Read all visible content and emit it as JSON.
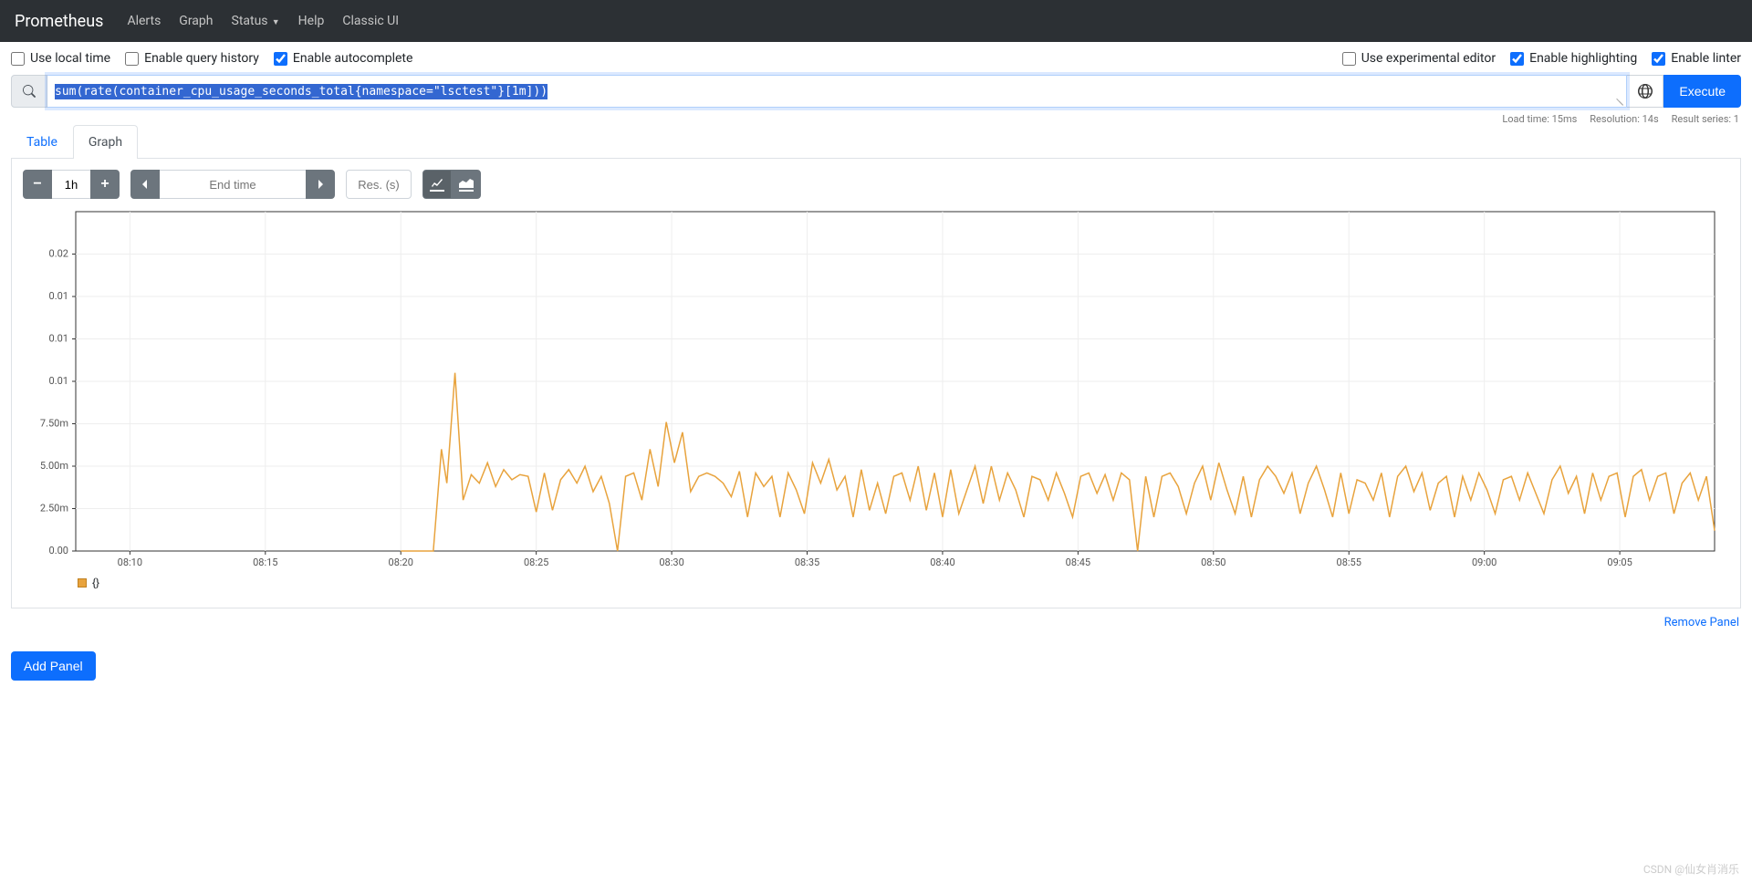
{
  "navbar": {
    "brand": "Prometheus",
    "links": [
      "Alerts",
      "Graph",
      "Status",
      "Help",
      "Classic UI"
    ],
    "status_has_caret": true
  },
  "options": {
    "use_local_time": "Use local time",
    "enable_query_history": "Enable query history",
    "enable_autocomplete": "Enable autocomplete",
    "use_experimental_editor": "Use experimental editor",
    "enable_highlighting": "Enable highlighting",
    "enable_linter": "Enable linter",
    "checked": {
      "use_local_time": false,
      "enable_query_history": false,
      "enable_autocomplete": true,
      "use_experimental_editor": false,
      "enable_highlighting": true,
      "enable_linter": true
    }
  },
  "query": {
    "expression": "sum(rate(container_cpu_usage_seconds_total{namespace=\"lsctest\"}[1m]))",
    "execute_label": "Execute"
  },
  "meta": {
    "load_time": "Load time: 15ms",
    "resolution": "Resolution: 14s",
    "result_series": "Result series: 1"
  },
  "tabs": {
    "table": "Table",
    "graph": "Graph",
    "active": "graph"
  },
  "controls": {
    "range": "1h",
    "end_time_placeholder": "End time",
    "res_placeholder": "Res. (s)"
  },
  "legend": {
    "label": "{}"
  },
  "actions": {
    "remove_panel": "Remove Panel",
    "add_panel": "Add Panel"
  },
  "watermark": "CSDN @仙女肖消乐",
  "chart_data": {
    "type": "line",
    "title": "",
    "xlabel": "",
    "ylabel": "",
    "ylim": [
      0,
      0.02
    ],
    "y_ticks": [
      "0.00",
      "2.50m",
      "5.00m",
      "7.50m",
      "0.01",
      "0.01",
      "0.01",
      "0.02"
    ],
    "y_tick_values": [
      0,
      0.0025,
      0.005,
      0.0075,
      0.01,
      0.0125,
      0.015,
      0.0175
    ],
    "x_ticks": [
      "08:10",
      "08:15",
      "08:20",
      "08:25",
      "08:30",
      "08:35",
      "08:40",
      "08:45",
      "08:50",
      "08:55",
      "09:00",
      "09:05"
    ],
    "x_tick_values": [
      0,
      5,
      10,
      15,
      20,
      25,
      30,
      35,
      40,
      45,
      50,
      55
    ],
    "x_range": [
      -2,
      58.5
    ],
    "series": [
      {
        "name": "{}",
        "color": "#e8a33d",
        "points": [
          [
            10.0,
            0.0
          ],
          [
            10.3,
            0.0
          ],
          [
            10.6,
            0.0
          ],
          [
            10.9,
            0.0
          ],
          [
            11.2,
            0.0
          ],
          [
            11.5,
            0.006
          ],
          [
            11.7,
            0.004
          ],
          [
            12.0,
            0.0105
          ],
          [
            12.3,
            0.003
          ],
          [
            12.6,
            0.0045
          ],
          [
            12.9,
            0.004
          ],
          [
            13.2,
            0.0052
          ],
          [
            13.5,
            0.0038
          ],
          [
            13.8,
            0.0048
          ],
          [
            14.1,
            0.0042
          ],
          [
            14.4,
            0.0045
          ],
          [
            14.7,
            0.0044
          ],
          [
            15.0,
            0.0023
          ],
          [
            15.3,
            0.0046
          ],
          [
            15.6,
            0.0024
          ],
          [
            15.9,
            0.0042
          ],
          [
            16.2,
            0.0048
          ],
          [
            16.5,
            0.004
          ],
          [
            16.8,
            0.005
          ],
          [
            17.1,
            0.0035
          ],
          [
            17.4,
            0.0044
          ],
          [
            17.7,
            0.0028
          ],
          [
            18.0,
            0.0
          ],
          [
            18.3,
            0.0044
          ],
          [
            18.6,
            0.0046
          ],
          [
            18.9,
            0.003
          ],
          [
            19.2,
            0.006
          ],
          [
            19.5,
            0.0038
          ],
          [
            19.8,
            0.0076
          ],
          [
            20.1,
            0.0052
          ],
          [
            20.4,
            0.007
          ],
          [
            20.7,
            0.0035
          ],
          [
            21.0,
            0.0044
          ],
          [
            21.3,
            0.0046
          ],
          [
            21.6,
            0.0044
          ],
          [
            21.9,
            0.004
          ],
          [
            22.2,
            0.0032
          ],
          [
            22.5,
            0.0047
          ],
          [
            22.8,
            0.002
          ],
          [
            23.1,
            0.0046
          ],
          [
            23.4,
            0.0038
          ],
          [
            23.7,
            0.0044
          ],
          [
            24.0,
            0.002
          ],
          [
            24.3,
            0.0046
          ],
          [
            24.6,
            0.0036
          ],
          [
            24.9,
            0.0022
          ],
          [
            25.2,
            0.0052
          ],
          [
            25.5,
            0.004
          ],
          [
            25.8,
            0.0054
          ],
          [
            26.1,
            0.0036
          ],
          [
            26.4,
            0.0044
          ],
          [
            26.7,
            0.002
          ],
          [
            27.0,
            0.0048
          ],
          [
            27.3,
            0.0024
          ],
          [
            27.6,
            0.004
          ],
          [
            27.9,
            0.0022
          ],
          [
            28.2,
            0.0044
          ],
          [
            28.5,
            0.0046
          ],
          [
            28.8,
            0.003
          ],
          [
            29.1,
            0.005
          ],
          [
            29.4,
            0.0024
          ],
          [
            29.7,
            0.0046
          ],
          [
            30.0,
            0.002
          ],
          [
            30.3,
            0.0048
          ],
          [
            30.6,
            0.0022
          ],
          [
            30.9,
            0.0036
          ],
          [
            31.2,
            0.005
          ],
          [
            31.5,
            0.0028
          ],
          [
            31.8,
            0.005
          ],
          [
            32.1,
            0.003
          ],
          [
            32.4,
            0.0046
          ],
          [
            32.7,
            0.0036
          ],
          [
            33.0,
            0.002
          ],
          [
            33.3,
            0.0044
          ],
          [
            33.6,
            0.0042
          ],
          [
            33.9,
            0.003
          ],
          [
            34.2,
            0.0046
          ],
          [
            34.5,
            0.0034
          ],
          [
            34.8,
            0.002
          ],
          [
            35.1,
            0.0044
          ],
          [
            35.4,
            0.0046
          ],
          [
            35.7,
            0.0034
          ],
          [
            36.0,
            0.0045
          ],
          [
            36.3,
            0.003
          ],
          [
            36.6,
            0.0046
          ],
          [
            36.9,
            0.0042
          ],
          [
            37.2,
            0.0
          ],
          [
            37.5,
            0.0044
          ],
          [
            37.8,
            0.002
          ],
          [
            38.1,
            0.0044
          ],
          [
            38.4,
            0.0046
          ],
          [
            38.7,
            0.0038
          ],
          [
            39.0,
            0.0022
          ],
          [
            39.3,
            0.004
          ],
          [
            39.6,
            0.005
          ],
          [
            39.9,
            0.003
          ],
          [
            40.2,
            0.0052
          ],
          [
            40.5,
            0.0036
          ],
          [
            40.8,
            0.0022
          ],
          [
            41.1,
            0.0044
          ],
          [
            41.4,
            0.002
          ],
          [
            41.7,
            0.0042
          ],
          [
            42.0,
            0.005
          ],
          [
            42.3,
            0.0044
          ],
          [
            42.6,
            0.0034
          ],
          [
            42.9,
            0.0046
          ],
          [
            43.2,
            0.0022
          ],
          [
            43.5,
            0.004
          ],
          [
            43.8,
            0.005
          ],
          [
            44.1,
            0.0036
          ],
          [
            44.4,
            0.002
          ],
          [
            44.7,
            0.0046
          ],
          [
            45.0,
            0.0022
          ],
          [
            45.3,
            0.0042
          ],
          [
            45.6,
            0.004
          ],
          [
            45.9,
            0.003
          ],
          [
            46.2,
            0.0046
          ],
          [
            46.5,
            0.002
          ],
          [
            46.8,
            0.0044
          ],
          [
            47.1,
            0.005
          ],
          [
            47.4,
            0.0035
          ],
          [
            47.7,
            0.0046
          ],
          [
            48.0,
            0.0024
          ],
          [
            48.3,
            0.004
          ],
          [
            48.6,
            0.0044
          ],
          [
            48.9,
            0.002
          ],
          [
            49.2,
            0.0044
          ],
          [
            49.5,
            0.003
          ],
          [
            49.8,
            0.0046
          ],
          [
            50.1,
            0.0036
          ],
          [
            50.4,
            0.0022
          ],
          [
            50.7,
            0.0042
          ],
          [
            51.0,
            0.0044
          ],
          [
            51.3,
            0.003
          ],
          [
            51.6,
            0.0046
          ],
          [
            51.9,
            0.0034
          ],
          [
            52.2,
            0.0022
          ],
          [
            52.5,
            0.0042
          ],
          [
            52.8,
            0.005
          ],
          [
            53.1,
            0.0034
          ],
          [
            53.4,
            0.0044
          ],
          [
            53.7,
            0.0022
          ],
          [
            54.0,
            0.0046
          ],
          [
            54.3,
            0.003
          ],
          [
            54.6,
            0.0044
          ],
          [
            54.9,
            0.0046
          ],
          [
            55.2,
            0.002
          ],
          [
            55.5,
            0.0044
          ],
          [
            55.8,
            0.0048
          ],
          [
            56.1,
            0.003
          ],
          [
            56.4,
            0.0044
          ],
          [
            56.7,
            0.0046
          ],
          [
            57.0,
            0.0022
          ],
          [
            57.3,
            0.004
          ],
          [
            57.6,
            0.0046
          ],
          [
            57.9,
            0.003
          ],
          [
            58.2,
            0.0044
          ],
          [
            58.5,
            0.0012
          ]
        ]
      }
    ]
  }
}
